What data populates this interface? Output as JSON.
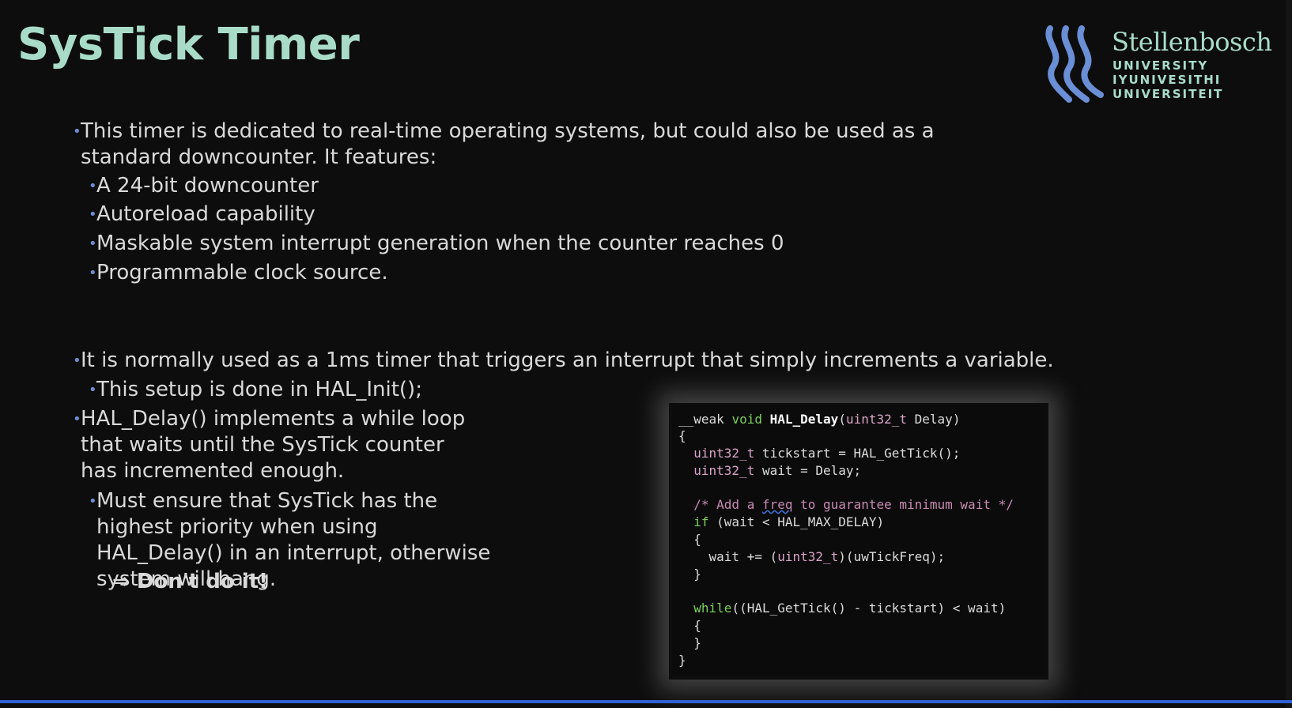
{
  "slide": {
    "title": "SysTick Timer"
  },
  "logo": {
    "name": "Stellenbosch",
    "line1": "UNIVERSITY",
    "line2": "IYUNIVESITHI",
    "line3": "UNIVERSITEIT"
  },
  "bullets": [
    {
      "text": "This timer is dedicated to real-time operating systems, but could also be used as a standard downcounter. It features:"
    },
    {
      "text": "A 24-bit downcounter"
    },
    {
      "text": "Autoreload capability"
    },
    {
      "text": "Maskable system interrupt generation when the counter reaches 0"
    },
    {
      "text": "Programmable clock source."
    },
    {
      "text": "It is normally used as a 1ms timer that triggers an interrupt that simply increments a variable."
    },
    {
      "text": "This setup is done in HAL_Init();"
    },
    {
      "text": "HAL_Delay() implements a while loop that waits until the SysTick counter has incremented enough."
    },
    {
      "text": "Must ensure that SysTick has the highest priority when using HAL_Delay() in an interrupt, otherwise system will hang."
    }
  ],
  "callout": {
    "arrow": "⇒",
    "text": "Don't do it!"
  },
  "code": {
    "l1_weak": "__weak",
    "l1_void": "void",
    "l1_fn": "HAL_Delay",
    "l1_paren": "(",
    "l1_type": "uint32_t",
    "l1_rest": " Delay)",
    "l2": "{",
    "l3_type": "uint32_t",
    "l3_rest": " tickstart = HAL_GetTick();",
    "l4_type": "uint32_t",
    "l4_rest": " wait = Delay;",
    "l5_a": "/* Add a ",
    "l5_freq": "freq",
    "l5_b": " to guarantee minimum wait */",
    "l6_if": "if",
    "l6_rest": " (wait < HAL_MAX_DELAY)",
    "l7": "{",
    "l8_a": "wait += (",
    "l8_type": "uint32_t",
    "l8_b": ")(uwTickFreq);",
    "l9": "}",
    "l10_while": "while",
    "l10_rest": "((HAL_GetTick() - tickstart) < wait)",
    "l11": "{",
    "l12": "}",
    "l13": "}"
  },
  "colors": {
    "title": "#a8dcc9",
    "bullet_dot": "#6a8fd6",
    "accent_bar": "#2f62d4",
    "background": "#0d0d0d"
  }
}
